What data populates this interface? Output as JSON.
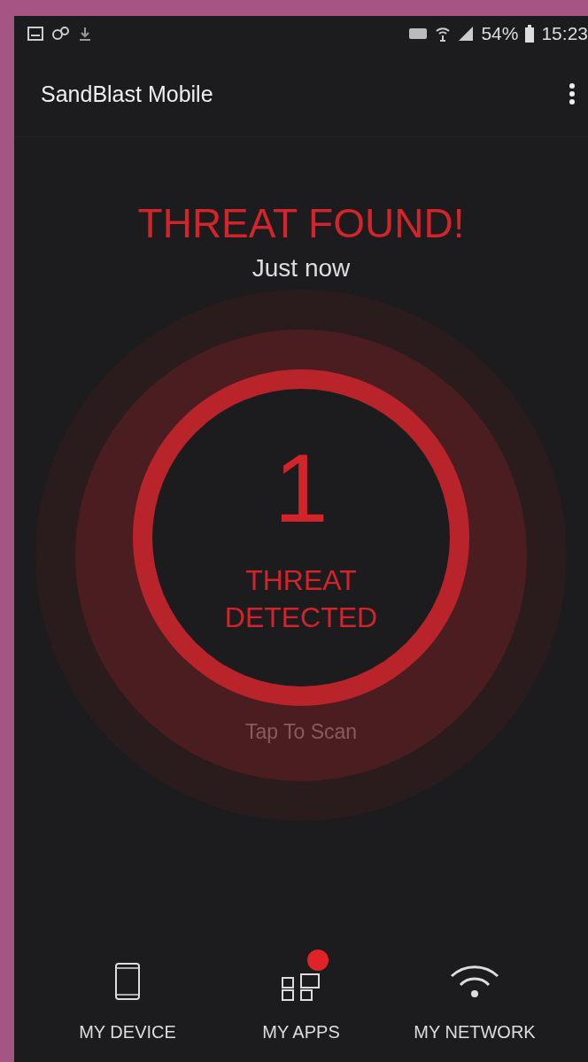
{
  "status_bar": {
    "battery": "54%",
    "time": "15:23"
  },
  "app_bar": {
    "title": "SandBlast Mobile"
  },
  "status": {
    "headline": "THREAT FOUND!",
    "time": "Just now"
  },
  "gauge": {
    "count": "1",
    "label_lines": [
      "THREAT",
      "DETECTED"
    ],
    "action": "Tap To Scan"
  },
  "nav": [
    {
      "kind": "device",
      "label": "MY DEVICE",
      "badge": false
    },
    {
      "kind": "apps",
      "label": "MY APPS",
      "badge": true
    },
    {
      "kind": "network",
      "label": "MY NETWORK",
      "badge": false
    }
  ]
}
